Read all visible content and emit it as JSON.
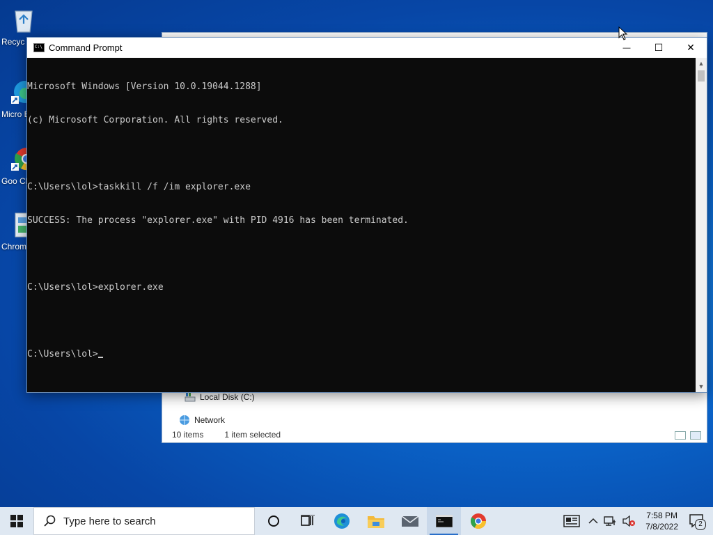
{
  "desktop": {
    "icons": [
      {
        "label": "Recyc",
        "icon": "recycle-bin-icon"
      },
      {
        "label": "Micro Ed",
        "icon": "edge-shortcut-icon"
      },
      {
        "label": "Goo Chro",
        "icon": "chrome-shortcut-icon"
      },
      {
        "label": "Chrom",
        "icon": "chrome-installer-icon"
      }
    ]
  },
  "explorer": {
    "items": [
      {
        "label": "Local Disk (C:)",
        "icon": "local-disk-icon"
      },
      {
        "label": "Network",
        "icon": "network-icon"
      }
    ],
    "status": {
      "count": "10 items",
      "selected": "1 item selected"
    }
  },
  "cmd": {
    "title": "Command Prompt",
    "lines": [
      "Microsoft Windows [Version 10.0.19044.1288]",
      "(c) Microsoft Corporation. All rights reserved.",
      "",
      "C:\\Users\\lol>taskkill /f /im explorer.exe",
      "SUCCESS: The process \"explorer.exe\" with PID 4916 has been terminated.",
      "",
      "C:\\Users\\lol>explorer.exe",
      "",
      "C:\\Users\\lol>"
    ],
    "buttons": {
      "minimize": "—",
      "maximize": "☐",
      "close": "✕"
    }
  },
  "taskbar": {
    "search_placeholder": "Type here to search",
    "pinned": [
      "cortana-icon",
      "task-view-icon",
      "edge-icon",
      "file-explorer-icon",
      "mail-icon",
      "command-prompt-icon",
      "chrome-icon"
    ],
    "clock": {
      "time": "7:58 PM",
      "date": "7/8/2022"
    },
    "notifications_count": "2"
  },
  "colors": {
    "console_bg": "#0c0c0c",
    "console_fg": "#cccccc",
    "taskbar_bg": "#dfe8f2"
  }
}
